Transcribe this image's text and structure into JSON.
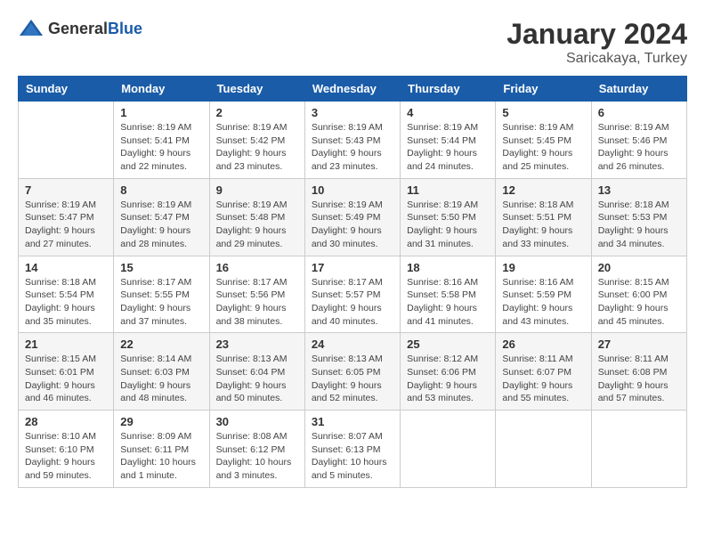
{
  "header": {
    "logo_general": "General",
    "logo_blue": "Blue",
    "month_title": "January 2024",
    "location": "Saricakaya, Turkey"
  },
  "days_of_week": [
    "Sunday",
    "Monday",
    "Tuesday",
    "Wednesday",
    "Thursday",
    "Friday",
    "Saturday"
  ],
  "weeks": [
    [
      {
        "day": "",
        "sunrise": "",
        "sunset": "",
        "daylight": ""
      },
      {
        "day": "1",
        "sunrise": "Sunrise: 8:19 AM",
        "sunset": "Sunset: 5:41 PM",
        "daylight": "Daylight: 9 hours and 22 minutes."
      },
      {
        "day": "2",
        "sunrise": "Sunrise: 8:19 AM",
        "sunset": "Sunset: 5:42 PM",
        "daylight": "Daylight: 9 hours and 23 minutes."
      },
      {
        "day": "3",
        "sunrise": "Sunrise: 8:19 AM",
        "sunset": "Sunset: 5:43 PM",
        "daylight": "Daylight: 9 hours and 23 minutes."
      },
      {
        "day": "4",
        "sunrise": "Sunrise: 8:19 AM",
        "sunset": "Sunset: 5:44 PM",
        "daylight": "Daylight: 9 hours and 24 minutes."
      },
      {
        "day": "5",
        "sunrise": "Sunrise: 8:19 AM",
        "sunset": "Sunset: 5:45 PM",
        "daylight": "Daylight: 9 hours and 25 minutes."
      },
      {
        "day": "6",
        "sunrise": "Sunrise: 8:19 AM",
        "sunset": "Sunset: 5:46 PM",
        "daylight": "Daylight: 9 hours and 26 minutes."
      }
    ],
    [
      {
        "day": "7",
        "sunrise": "Sunrise: 8:19 AM",
        "sunset": "Sunset: 5:47 PM",
        "daylight": "Daylight: 9 hours and 27 minutes."
      },
      {
        "day": "8",
        "sunrise": "Sunrise: 8:19 AM",
        "sunset": "Sunset: 5:47 PM",
        "daylight": "Daylight: 9 hours and 28 minutes."
      },
      {
        "day": "9",
        "sunrise": "Sunrise: 8:19 AM",
        "sunset": "Sunset: 5:48 PM",
        "daylight": "Daylight: 9 hours and 29 minutes."
      },
      {
        "day": "10",
        "sunrise": "Sunrise: 8:19 AM",
        "sunset": "Sunset: 5:49 PM",
        "daylight": "Daylight: 9 hours and 30 minutes."
      },
      {
        "day": "11",
        "sunrise": "Sunrise: 8:19 AM",
        "sunset": "Sunset: 5:50 PM",
        "daylight": "Daylight: 9 hours and 31 minutes."
      },
      {
        "day": "12",
        "sunrise": "Sunrise: 8:18 AM",
        "sunset": "Sunset: 5:51 PM",
        "daylight": "Daylight: 9 hours and 33 minutes."
      },
      {
        "day": "13",
        "sunrise": "Sunrise: 8:18 AM",
        "sunset": "Sunset: 5:53 PM",
        "daylight": "Daylight: 9 hours and 34 minutes."
      }
    ],
    [
      {
        "day": "14",
        "sunrise": "Sunrise: 8:18 AM",
        "sunset": "Sunset: 5:54 PM",
        "daylight": "Daylight: 9 hours and 35 minutes."
      },
      {
        "day": "15",
        "sunrise": "Sunrise: 8:17 AM",
        "sunset": "Sunset: 5:55 PM",
        "daylight": "Daylight: 9 hours and 37 minutes."
      },
      {
        "day": "16",
        "sunrise": "Sunrise: 8:17 AM",
        "sunset": "Sunset: 5:56 PM",
        "daylight": "Daylight: 9 hours and 38 minutes."
      },
      {
        "day": "17",
        "sunrise": "Sunrise: 8:17 AM",
        "sunset": "Sunset: 5:57 PM",
        "daylight": "Daylight: 9 hours and 40 minutes."
      },
      {
        "day": "18",
        "sunrise": "Sunrise: 8:16 AM",
        "sunset": "Sunset: 5:58 PM",
        "daylight": "Daylight: 9 hours and 41 minutes."
      },
      {
        "day": "19",
        "sunrise": "Sunrise: 8:16 AM",
        "sunset": "Sunset: 5:59 PM",
        "daylight": "Daylight: 9 hours and 43 minutes."
      },
      {
        "day": "20",
        "sunrise": "Sunrise: 8:15 AM",
        "sunset": "Sunset: 6:00 PM",
        "daylight": "Daylight: 9 hours and 45 minutes."
      }
    ],
    [
      {
        "day": "21",
        "sunrise": "Sunrise: 8:15 AM",
        "sunset": "Sunset: 6:01 PM",
        "daylight": "Daylight: 9 hours and 46 minutes."
      },
      {
        "day": "22",
        "sunrise": "Sunrise: 8:14 AM",
        "sunset": "Sunset: 6:03 PM",
        "daylight": "Daylight: 9 hours and 48 minutes."
      },
      {
        "day": "23",
        "sunrise": "Sunrise: 8:13 AM",
        "sunset": "Sunset: 6:04 PM",
        "daylight": "Daylight: 9 hours and 50 minutes."
      },
      {
        "day": "24",
        "sunrise": "Sunrise: 8:13 AM",
        "sunset": "Sunset: 6:05 PM",
        "daylight": "Daylight: 9 hours and 52 minutes."
      },
      {
        "day": "25",
        "sunrise": "Sunrise: 8:12 AM",
        "sunset": "Sunset: 6:06 PM",
        "daylight": "Daylight: 9 hours and 53 minutes."
      },
      {
        "day": "26",
        "sunrise": "Sunrise: 8:11 AM",
        "sunset": "Sunset: 6:07 PM",
        "daylight": "Daylight: 9 hours and 55 minutes."
      },
      {
        "day": "27",
        "sunrise": "Sunrise: 8:11 AM",
        "sunset": "Sunset: 6:08 PM",
        "daylight": "Daylight: 9 hours and 57 minutes."
      }
    ],
    [
      {
        "day": "28",
        "sunrise": "Sunrise: 8:10 AM",
        "sunset": "Sunset: 6:10 PM",
        "daylight": "Daylight: 9 hours and 59 minutes."
      },
      {
        "day": "29",
        "sunrise": "Sunrise: 8:09 AM",
        "sunset": "Sunset: 6:11 PM",
        "daylight": "Daylight: 10 hours and 1 minute."
      },
      {
        "day": "30",
        "sunrise": "Sunrise: 8:08 AM",
        "sunset": "Sunset: 6:12 PM",
        "daylight": "Daylight: 10 hours and 3 minutes."
      },
      {
        "day": "31",
        "sunrise": "Sunrise: 8:07 AM",
        "sunset": "Sunset: 6:13 PM",
        "daylight": "Daylight: 10 hours and 5 minutes."
      },
      {
        "day": "",
        "sunrise": "",
        "sunset": "",
        "daylight": ""
      },
      {
        "day": "",
        "sunrise": "",
        "sunset": "",
        "daylight": ""
      },
      {
        "day": "",
        "sunrise": "",
        "sunset": "",
        "daylight": ""
      }
    ]
  ]
}
